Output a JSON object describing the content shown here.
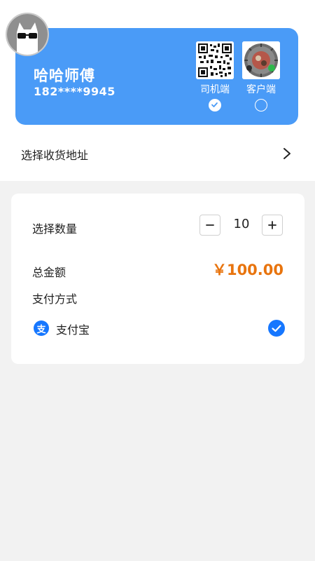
{
  "profile": {
    "name": "哈哈师傅",
    "phone": "182****9945",
    "qr_options": [
      {
        "label": "司机端",
        "selected": true
      },
      {
        "label": "客户端",
        "selected": false
      }
    ]
  },
  "address": {
    "label": "选择收货地址"
  },
  "order": {
    "quantity_label": "选择数量",
    "quantity": "10",
    "minus_symbol": "−",
    "plus_symbol": "+",
    "total_label": "总金额",
    "total_value": "￥100.00",
    "payment_label": "支付方式",
    "payment_method": {
      "name": "支付宝",
      "icon_glyph": "支",
      "selected": true
    }
  },
  "colors": {
    "card_blue": "#4a9bf7",
    "accent_orange": "#e8740e",
    "alipay_blue": "#1677ff",
    "page_bg": "#f2f2f2"
  },
  "icons": {
    "avatar": "cat-with-sunglasses-avatar",
    "address_arrow": "chevron-right-icon",
    "driver_qr": "qr-code-icon",
    "customer_qr": "mini-program-code-icon",
    "payment": "alipay-icon",
    "payment_selected": "check-circle-icon"
  }
}
